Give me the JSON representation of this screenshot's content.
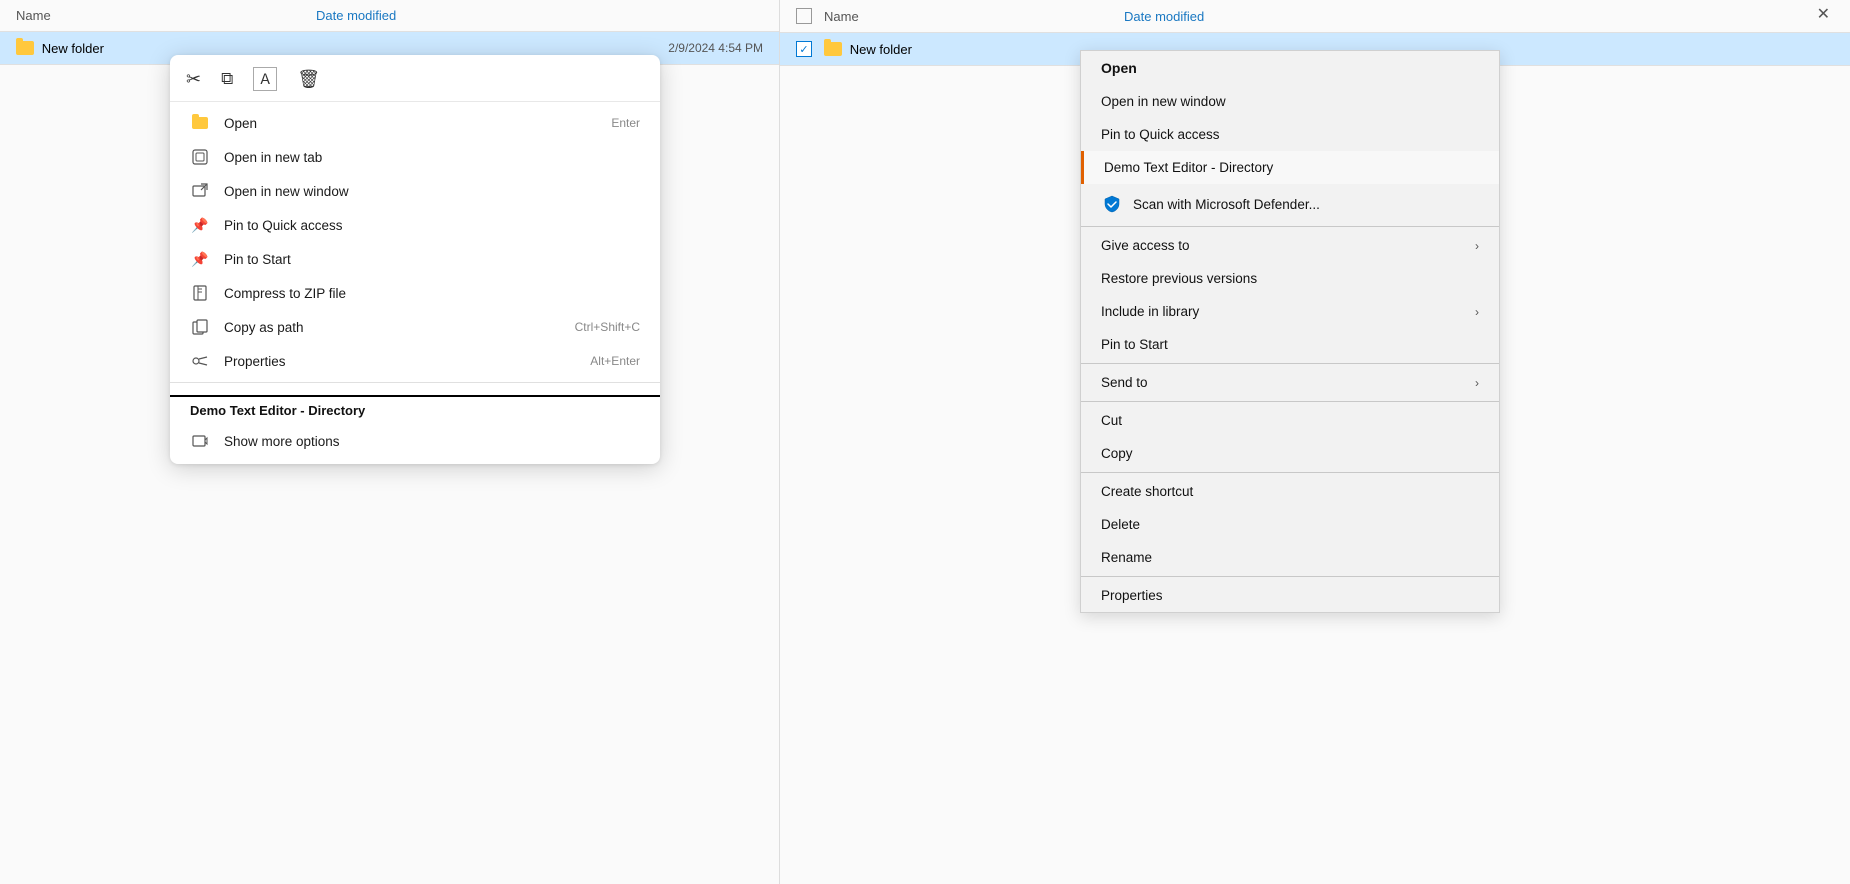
{
  "left_panel": {
    "columns": {
      "name": "Name",
      "date_modified": "Date modified"
    },
    "folder": {
      "name": "New folder",
      "date": "2/9/2024 4:54 PM"
    },
    "toolbar": {
      "cut_icon": "✂",
      "copy_icon": "⧉",
      "rename_icon": "Ａ",
      "delete_icon": "🗑"
    },
    "menu_items": [
      {
        "id": "open",
        "label": "Open",
        "shortcut": "Enter",
        "icon": "📁"
      },
      {
        "id": "open-new-tab",
        "label": "Open in new tab",
        "shortcut": "",
        "icon": "⊡"
      },
      {
        "id": "open-new-window",
        "label": "Open in new window",
        "shortcut": "",
        "icon": "⬚"
      },
      {
        "id": "pin-quick-access",
        "label": "Pin to Quick access",
        "shortcut": "",
        "icon": "📌"
      },
      {
        "id": "pin-start",
        "label": "Pin to Start",
        "shortcut": "",
        "icon": "📌"
      },
      {
        "id": "compress-zip",
        "label": "Compress to ZIP file",
        "shortcut": "",
        "icon": "🗜"
      },
      {
        "id": "copy-as-path",
        "label": "Copy as path",
        "shortcut": "Ctrl+Shift+C",
        "icon": "🔗"
      },
      {
        "id": "properties",
        "label": "Properties",
        "shortcut": "Alt+Enter",
        "icon": "🔧"
      }
    ],
    "section_label": "Demo Text Editor - Directory",
    "show_more": {
      "label": "Show more options",
      "icon": "⬚"
    }
  },
  "right_panel": {
    "columns": {
      "name": "Name",
      "date_modified": "Date modified"
    },
    "folder": {
      "name": "New folder"
    },
    "close_btn": "✕",
    "menu_items": [
      {
        "id": "open",
        "label": "Open",
        "bold": true,
        "has_arrow": false,
        "has_icon": false
      },
      {
        "id": "open-new-window",
        "label": "Open in new window",
        "bold": false,
        "has_arrow": false,
        "has_icon": false
      },
      {
        "id": "pin-quick-access",
        "label": "Pin to Quick access",
        "bold": false,
        "has_arrow": false,
        "has_icon": false
      },
      {
        "id": "demo-text-editor",
        "label": "Demo Text Editor - Directory",
        "bold": false,
        "has_arrow": false,
        "has_icon": false,
        "highlighted": true
      },
      {
        "id": "scan-defender",
        "label": "Scan with Microsoft Defender...",
        "bold": false,
        "has_arrow": false,
        "has_icon": true
      },
      {
        "id": "sep1",
        "separator": true
      },
      {
        "id": "give-access",
        "label": "Give access to",
        "bold": false,
        "has_arrow": true,
        "has_icon": false
      },
      {
        "id": "restore-versions",
        "label": "Restore previous versions",
        "bold": false,
        "has_arrow": false,
        "has_icon": false
      },
      {
        "id": "include-library",
        "label": "Include in library",
        "bold": false,
        "has_arrow": true,
        "has_icon": false
      },
      {
        "id": "pin-start",
        "label": "Pin to Start",
        "bold": false,
        "has_arrow": false,
        "has_icon": false
      },
      {
        "id": "sep2",
        "separator": true
      },
      {
        "id": "send-to",
        "label": "Send to",
        "bold": false,
        "has_arrow": true,
        "has_icon": false
      },
      {
        "id": "sep3",
        "separator": true
      },
      {
        "id": "cut",
        "label": "Cut",
        "bold": false,
        "has_arrow": false,
        "has_icon": false
      },
      {
        "id": "copy",
        "label": "Copy",
        "bold": false,
        "has_arrow": false,
        "has_icon": false
      },
      {
        "id": "sep4",
        "separator": true
      },
      {
        "id": "create-shortcut",
        "label": "Create shortcut",
        "bold": false,
        "has_arrow": false,
        "has_icon": false
      },
      {
        "id": "delete",
        "label": "Delete",
        "bold": false,
        "has_arrow": false,
        "has_icon": false
      },
      {
        "id": "rename",
        "label": "Rename",
        "bold": false,
        "has_arrow": false,
        "has_icon": false
      },
      {
        "id": "sep5",
        "separator": true
      },
      {
        "id": "properties",
        "label": "Properties",
        "bold": false,
        "has_arrow": false,
        "has_icon": false
      }
    ]
  }
}
